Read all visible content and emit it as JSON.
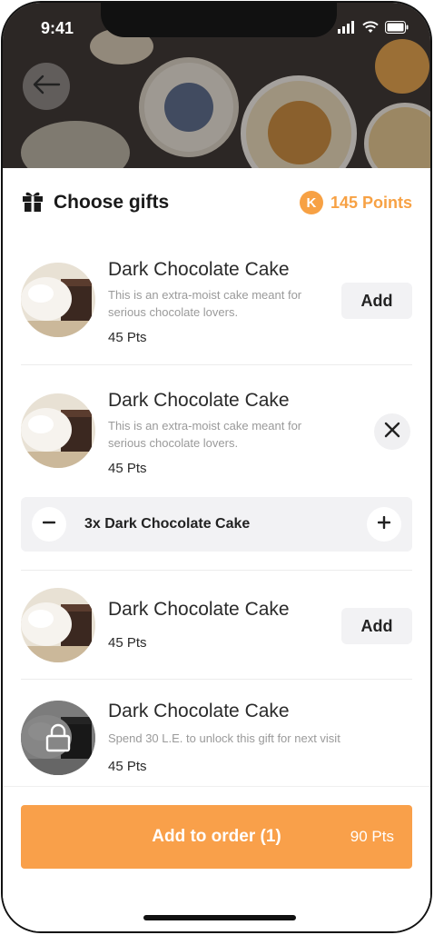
{
  "status_bar": {
    "time": "9:41"
  },
  "header": {
    "title": "Choose gifts",
    "points_badge": "K",
    "points": "145 Points"
  },
  "items": [
    {
      "name": "Dark Chocolate Cake",
      "description": "This is an extra-moist cake meant for serious chocolate lovers.",
      "points": "45 Pts",
      "action_label": "Add"
    },
    {
      "name": "Dark Chocolate Cake",
      "description": "This is an extra-moist cake meant for serious chocolate lovers.",
      "points": "45 Pts"
    },
    {
      "name": "Dark Chocolate Cake",
      "points": "45 Pts",
      "action_label": "Add"
    },
    {
      "name": "Dark Chocolate Cake",
      "description": "Spend 30 L.E. to unlock this gift for next visit",
      "points": "45 Pts"
    }
  ],
  "quantity": {
    "label": "3x Dark Chocolate Cake"
  },
  "order_button": {
    "label": "Add to order (1)",
    "points": "90 Pts"
  },
  "colors": {
    "accent": "#f9a04a",
    "points_text": "#f7a144",
    "button_gray": "#f2f2f4"
  },
  "icons": {
    "back": "arrow-left-icon",
    "gift": "gift-icon",
    "remove": "close-icon",
    "decrease": "minus-icon",
    "increase": "plus-icon",
    "lock": "lock-icon"
  }
}
